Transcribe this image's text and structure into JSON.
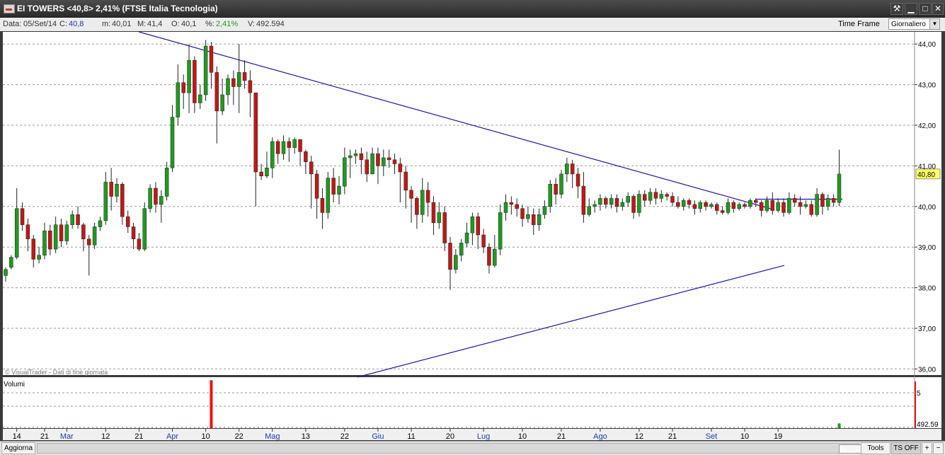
{
  "window": {
    "title": "EI TOWERS <40,8> 2,41%  (FTSE Italia Tecnologia)",
    "btn_tools": "⚒",
    "btn_min": "▁",
    "btn_max": "□",
    "btn_close": "✕"
  },
  "infobar": {
    "data_label": "Data:",
    "data_value": "05/Set/14",
    "c_label": "C:",
    "c_value": "40,8",
    "m_label": "m:",
    "m_value": "40,01",
    "M_label": "M:",
    "M_value": "41,4",
    "o_label": "O:",
    "o_value": "40,1",
    "pct_label": "%:",
    "pct_value": "2,41%",
    "v_label": "V:",
    "v_value": "492.594",
    "time_frame_label": "Time Frame",
    "time_frame_value": "Giornaliero"
  },
  "watermark": "© VisualTrader - Dati di fine giornata",
  "volume_label": "Volumi",
  "bottombar": {
    "aggiorna": "Aggiorna",
    "tools": "Tools",
    "ts_off": "TS OFF",
    "plus": "+",
    "minus": "−"
  },
  "colors": {
    "up": "#1f9a1f",
    "down": "#c01818",
    "trendline": "#1a1aa0",
    "last_price_bg": "#ffff66"
  },
  "chart_data": {
    "type": "candlestick",
    "title": "EI TOWERS",
    "y_ticks": [
      "36,00",
      "37,00",
      "38,00",
      "39,00",
      "40,00",
      "41,00",
      "42,00",
      "43,00",
      "44,00"
    ],
    "ylim": [
      35.85,
      44.3
    ],
    "last_price_label": "40,80",
    "volume_ticks": [
      "5",
      "492.59"
    ],
    "x_tick_labels": [
      {
        "label": "14",
        "month": false,
        "i": 2
      },
      {
        "label": "21",
        "month": false,
        "i": 7
      },
      {
        "label": "Mar",
        "month": true,
        "i": 11
      },
      {
        "label": "12",
        "month": false,
        "i": 18
      },
      {
        "label": "21",
        "month": false,
        "i": 24
      },
      {
        "label": "Apr",
        "month": true,
        "i": 30
      },
      {
        "label": "10",
        "month": false,
        "i": 36
      },
      {
        "label": "22",
        "month": false,
        "i": 42
      },
      {
        "label": "Mag",
        "month": true,
        "i": 48
      },
      {
        "label": "13",
        "month": false,
        "i": 54
      },
      {
        "label": "22",
        "month": false,
        "i": 61
      },
      {
        "label": "Giu",
        "month": true,
        "i": 67
      },
      {
        "label": "11",
        "month": false,
        "i": 73
      },
      {
        "label": "20",
        "month": false,
        "i": 80
      },
      {
        "label": "Lug",
        "month": true,
        "i": 86
      },
      {
        "label": "10",
        "month": false,
        "i": 93
      },
      {
        "label": "21",
        "month": false,
        "i": 100
      },
      {
        "label": "Ago",
        "month": true,
        "i": 107
      },
      {
        "label": "12",
        "month": false,
        "i": 114
      },
      {
        "label": "21",
        "month": false,
        "i": 120
      },
      {
        "label": "Set",
        "month": true,
        "i": 127
      },
      {
        "label": "10",
        "month": false,
        "i": 133
      },
      {
        "label": "19",
        "month": false,
        "i": 139
      }
    ],
    "candles": [
      [
        38.3,
        38.45,
        38.15,
        38.5
      ],
      [
        38.5,
        38.75,
        38.45,
        38.8
      ],
      [
        38.75,
        39.95,
        38.7,
        40.45
      ],
      [
        39.95,
        39.55,
        39.4,
        40.1
      ],
      [
        39.55,
        39.2,
        38.9,
        39.7
      ],
      [
        39.2,
        38.7,
        38.5,
        39.3
      ],
      [
        38.7,
        38.8,
        38.6,
        39.0
      ],
      [
        38.8,
        39.4,
        38.7,
        39.6
      ],
      [
        39.4,
        38.95,
        38.8,
        39.55
      ],
      [
        38.95,
        39.55,
        38.85,
        39.75
      ],
      [
        39.55,
        39.15,
        39.0,
        39.7
      ],
      [
        39.15,
        39.55,
        39.05,
        39.65
      ],
      [
        39.55,
        39.8,
        39.45,
        39.9
      ],
      [
        39.8,
        39.55,
        39.45,
        40.0
      ],
      [
        39.55,
        39.2,
        38.9,
        39.6
      ],
      [
        39.2,
        39.05,
        38.3,
        39.3
      ],
      [
        39.05,
        39.5,
        38.95,
        39.6
      ],
      [
        39.5,
        39.65,
        39.4,
        39.75
      ],
      [
        39.65,
        40.6,
        39.55,
        40.85
      ],
      [
        40.6,
        40.25,
        39.9,
        40.95
      ],
      [
        40.25,
        40.55,
        40.1,
        40.7
      ],
      [
        40.55,
        39.75,
        39.55,
        40.6
      ],
      [
        39.75,
        39.5,
        39.35,
        39.9
      ],
      [
        39.5,
        39.2,
        38.95,
        39.6
      ],
      [
        39.2,
        38.95,
        38.9,
        39.35
      ],
      [
        38.95,
        39.95,
        38.9,
        40.1
      ],
      [
        39.95,
        40.45,
        39.85,
        40.55
      ],
      [
        40.45,
        40.05,
        39.85,
        40.6
      ],
      [
        40.05,
        40.25,
        39.6,
        40.4
      ],
      [
        40.25,
        40.95,
        40.15,
        41.1
      ],
      [
        40.95,
        42.2,
        40.85,
        42.5
      ],
      [
        42.2,
        43.05,
        42.0,
        43.5
      ],
      [
        43.05,
        42.8,
        42.4,
        43.25
      ],
      [
        42.8,
        43.6,
        42.3,
        44.0
      ],
      [
        43.6,
        42.55,
        42.3,
        43.7
      ],
      [
        42.55,
        42.75,
        42.4,
        43.0
      ],
      [
        42.75,
        43.95,
        42.6,
        44.1
      ],
      [
        43.95,
        43.3,
        42.9,
        44.05
      ],
      [
        43.3,
        42.35,
        41.55,
        43.45
      ],
      [
        42.35,
        42.75,
        42.25,
        43.15
      ],
      [
        42.75,
        43.15,
        42.5,
        43.25
      ],
      [
        43.15,
        42.95,
        42.5,
        43.35
      ],
      [
        42.95,
        43.3,
        42.3,
        44.0
      ],
      [
        43.3,
        43.1,
        42.9,
        43.6
      ],
      [
        43.1,
        42.8,
        42.2,
        43.35
      ],
      [
        42.8,
        40.85,
        40.0,
        40.95
      ],
      [
        40.85,
        40.75,
        40.65,
        41.05
      ],
      [
        40.75,
        40.95,
        40.7,
        41.35
      ],
      [
        40.95,
        41.6,
        40.7,
        41.7
      ],
      [
        41.6,
        41.3,
        41.05,
        41.65
      ],
      [
        41.3,
        41.6,
        41.15,
        41.75
      ],
      [
        41.6,
        41.45,
        41.1,
        41.7
      ],
      [
        41.45,
        41.65,
        41.3,
        41.7
      ],
      [
        41.65,
        41.35,
        41.0,
        41.6
      ],
      [
        41.35,
        41.1,
        40.8,
        41.4
      ],
      [
        41.1,
        40.8,
        39.95,
        41.25
      ],
      [
        40.8,
        40.2,
        39.7,
        40.9
      ],
      [
        40.2,
        39.85,
        39.45,
        40.45
      ],
      [
        39.85,
        40.7,
        39.7,
        40.85
      ],
      [
        40.7,
        40.3,
        40.1,
        40.95
      ],
      [
        40.3,
        40.5,
        40.05,
        40.75
      ],
      [
        40.5,
        41.2,
        40.3,
        41.45
      ],
      [
        41.2,
        41.25,
        40.7,
        41.4
      ],
      [
        41.25,
        41.3,
        41.05,
        41.4
      ],
      [
        41.3,
        41.15,
        40.8,
        41.45
      ],
      [
        41.15,
        40.8,
        40.6,
        41.35
      ],
      [
        40.8,
        41.3,
        40.8,
        41.45
      ],
      [
        41.3,
        41.0,
        40.55,
        41.45
      ],
      [
        41.0,
        41.2,
        40.75,
        41.4
      ],
      [
        41.2,
        41.15,
        40.95,
        41.4
      ],
      [
        41.15,
        41.05,
        40.8,
        41.3
      ],
      [
        41.05,
        40.85,
        40.1,
        41.2
      ],
      [
        40.85,
        40.4,
        39.95,
        41.0
      ],
      [
        40.4,
        40.2,
        39.6,
        40.5
      ],
      [
        40.2,
        39.8,
        39.45,
        40.25
      ],
      [
        39.8,
        40.4,
        39.6,
        40.7
      ],
      [
        40.4,
        40.1,
        39.75,
        40.6
      ],
      [
        40.1,
        39.6,
        39.3,
        40.25
      ],
      [
        39.6,
        39.85,
        39.45,
        40.1
      ],
      [
        39.85,
        39.1,
        38.9,
        40.0
      ],
      [
        39.1,
        38.45,
        37.95,
        39.25
      ],
      [
        38.45,
        38.8,
        38.35,
        38.95
      ],
      [
        38.8,
        39.1,
        38.65,
        39.2
      ],
      [
        39.1,
        39.35,
        39.0,
        39.6
      ],
      [
        39.35,
        39.75,
        39.05,
        39.85
      ],
      [
        39.75,
        39.3,
        38.95,
        39.85
      ],
      [
        39.3,
        39.0,
        38.85,
        39.45
      ],
      [
        39.0,
        38.55,
        38.35,
        39.1
      ],
      [
        38.55,
        38.95,
        38.5,
        39.3
      ],
      [
        38.95,
        39.85,
        38.8,
        40.05
      ],
      [
        39.85,
        40.1,
        39.65,
        40.3
      ],
      [
        40.1,
        40.05,
        39.8,
        40.25
      ],
      [
        40.05,
        39.95,
        39.75,
        40.2
      ],
      [
        39.95,
        39.7,
        39.5,
        40.05
      ],
      [
        39.7,
        39.8,
        39.6,
        40.0
      ],
      [
        39.8,
        39.55,
        39.3,
        39.95
      ],
      [
        39.55,
        39.8,
        39.4,
        39.95
      ],
      [
        39.8,
        40.0,
        39.7,
        40.15
      ],
      [
        40.0,
        40.55,
        39.85,
        40.65
      ],
      [
        40.55,
        40.3,
        40.05,
        40.7
      ],
      [
        40.3,
        40.8,
        40.2,
        40.9
      ],
      [
        40.8,
        41.05,
        40.6,
        41.2
      ],
      [
        41.05,
        40.8,
        40.45,
        41.15
      ],
      [
        40.8,
        40.5,
        40.2,
        40.95
      ],
      [
        40.5,
        39.8,
        39.6,
        40.85
      ],
      [
        39.8,
        40.0,
        39.75,
        40.2
      ],
      [
        40.0,
        40.05,
        39.85,
        40.15
      ],
      [
        40.05,
        40.2,
        39.9,
        40.3
      ],
      [
        40.2,
        40.05,
        39.95,
        40.25
      ],
      [
        40.05,
        40.2,
        39.95,
        40.3
      ],
      [
        40.2,
        40.0,
        39.85,
        40.3
      ],
      [
        40.0,
        40.1,
        39.9,
        40.2
      ],
      [
        40.1,
        40.25,
        40.0,
        40.35
      ],
      [
        40.25,
        39.85,
        39.7,
        40.3
      ],
      [
        39.85,
        40.3,
        39.75,
        40.4
      ],
      [
        40.3,
        40.15,
        40.0,
        40.4
      ],
      [
        40.15,
        40.35,
        40.05,
        40.45
      ],
      [
        40.35,
        40.2,
        40.05,
        40.45
      ],
      [
        40.2,
        40.3,
        40.1,
        40.4
      ],
      [
        40.3,
        40.25,
        40.15,
        40.35
      ],
      [
        40.25,
        40.1,
        40.0,
        40.35
      ],
      [
        40.1,
        40.0,
        39.95,
        40.25
      ],
      [
        40.0,
        40.15,
        39.9,
        40.2
      ],
      [
        40.15,
        40.05,
        39.95,
        40.2
      ],
      [
        40.05,
        39.95,
        39.8,
        40.15
      ],
      [
        39.95,
        40.1,
        39.85,
        40.15
      ],
      [
        40.1,
        40.0,
        39.9,
        40.15
      ],
      [
        40.0,
        40.05,
        39.95,
        40.1
      ],
      [
        40.05,
        39.9,
        39.8,
        40.1
      ],
      [
        39.9,
        39.85,
        39.8,
        40.0
      ],
      [
        39.85,
        40.1,
        39.8,
        40.2
      ],
      [
        40.1,
        39.95,
        39.85,
        40.15
      ],
      [
        39.95,
        40.05,
        39.9,
        40.1
      ],
      [
        40.05,
        40.0,
        39.95,
        40.1
      ],
      [
        40.0,
        40.15,
        39.95,
        40.2
      ],
      [
        40.15,
        40.1,
        40.0,
        40.2
      ],
      [
        40.1,
        39.9,
        39.75,
        40.15
      ],
      [
        39.9,
        40.15,
        39.85,
        40.25
      ],
      [
        40.15,
        39.9,
        39.8,
        40.35
      ],
      [
        39.9,
        40.1,
        39.85,
        40.2
      ],
      [
        40.1,
        39.85,
        39.75,
        40.2
      ],
      [
        39.85,
        40.2,
        39.8,
        40.35
      ],
      [
        40.2,
        40.1,
        40.0,
        40.3
      ],
      [
        40.1,
        40.0,
        39.8,
        40.25
      ],
      [
        40.0,
        40.05,
        39.95,
        40.15
      ],
      [
        40.05,
        39.8,
        39.75,
        40.15
      ],
      [
        39.8,
        40.3,
        39.75,
        40.45
      ],
      [
        40.3,
        40.0,
        39.8,
        40.35
      ],
      [
        40.0,
        40.2,
        39.9,
        40.3
      ],
      [
        40.2,
        40.1,
        40.0,
        40.3
      ],
      [
        40.1,
        40.8,
        40.01,
        41.4
      ]
    ],
    "trendlines": [
      {
        "x1": 196,
        "y1": 44.3,
        "x2": 1094,
        "y2": 39.92
      },
      {
        "x1": 505,
        "y1": 35.8,
        "x2": 1108,
        "y2": 38.55
      },
      {
        "x1": 1067,
        "y1": 40.18,
        "x2": 1190,
        "y2": 40.18
      }
    ],
    "volume_spikes": [
      {
        "i": 37,
        "value": 5.1,
        "color": "#ee1111"
      },
      {
        "i": 150,
        "value": 0.5,
        "color": "#1f9a1f"
      }
    ]
  }
}
